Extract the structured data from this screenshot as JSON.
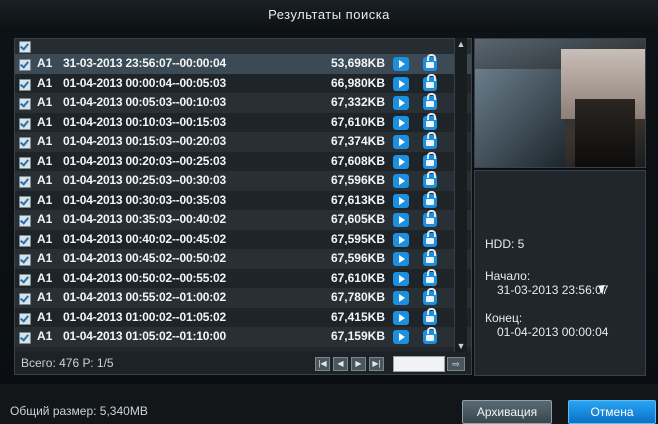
{
  "window": {
    "title": "Результаты поиска"
  },
  "list": {
    "rows": [
      {
        "channel": "A1",
        "range": "31-03-2013 23:56:07--00:00:04",
        "size": "53,698KB"
      },
      {
        "channel": "A1",
        "range": "01-04-2013 00:00:04--00:05:03",
        "size": "66,980KB"
      },
      {
        "channel": "A1",
        "range": "01-04-2013 00:05:03--00:10:03",
        "size": "67,332KB"
      },
      {
        "channel": "A1",
        "range": "01-04-2013 00:10:03--00:15:03",
        "size": "67,610KB"
      },
      {
        "channel": "A1",
        "range": "01-04-2013 00:15:03--00:20:03",
        "size": "67,374KB"
      },
      {
        "channel": "A1",
        "range": "01-04-2013 00:20:03--00:25:03",
        "size": "67,608KB"
      },
      {
        "channel": "A1",
        "range": "01-04-2013 00:25:03--00:30:03",
        "size": "67,596KB"
      },
      {
        "channel": "A1",
        "range": "01-04-2013 00:30:03--00:35:03",
        "size": "67,613KB"
      },
      {
        "channel": "A1",
        "range": "01-04-2013 00:35:03--00:40:02",
        "size": "67,605KB"
      },
      {
        "channel": "A1",
        "range": "01-04-2013 00:40:02--00:45:02",
        "size": "67,595KB"
      },
      {
        "channel": "A1",
        "range": "01-04-2013 00:45:02--00:50:02",
        "size": "67,596KB"
      },
      {
        "channel": "A1",
        "range": "01-04-2013 00:50:02--00:55:02",
        "size": "67,610KB"
      },
      {
        "channel": "A1",
        "range": "01-04-2013 00:55:02--01:00:02",
        "size": "67,780KB"
      },
      {
        "channel": "A1",
        "range": "01-04-2013 01:00:02--01:05:02",
        "size": "67,415KB"
      },
      {
        "channel": "A1",
        "range": "01-04-2013 01:05:02--01:10:00",
        "size": "67,159KB"
      }
    ]
  },
  "pager": {
    "total": "Всего: 476  Р: 1/5"
  },
  "info": {
    "hdd": "HDD: 5",
    "start_label": "Начало:",
    "start_value": "31-03-2013 23:56:07",
    "end_label": "Конец:",
    "end_value": "01-04-2013 00:00:04"
  },
  "footer": {
    "total_size": "Общий размер: 5,340MB",
    "archive_label": "Архивация",
    "cancel_label": "Отмена"
  },
  "icons": {
    "play": "play-icon",
    "lock": "lock-icon",
    "checkbox": "checkbox-icon"
  },
  "colors": {
    "accent": "#1b8fe0",
    "background": "#0d1216"
  }
}
